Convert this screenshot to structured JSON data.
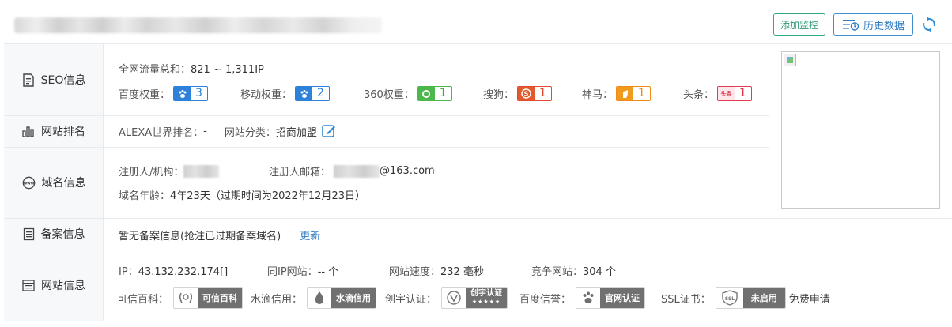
{
  "header": {
    "add_monitor": "添加监控",
    "history_data": "历史数据"
  },
  "rows": {
    "seo": {
      "label": "SEO信息"
    },
    "rank": {
      "label": "网站排名"
    },
    "domain": {
      "label": "域名信息"
    },
    "icp": {
      "label": "备案信息"
    },
    "site": {
      "label": "网站信息"
    }
  },
  "seo": {
    "traffic_label": "全网流量总和：",
    "traffic_value": "821 ~ 1,311IP",
    "weights": [
      {
        "label": "百度权重：",
        "value": "3",
        "color": "#2e81d8"
      },
      {
        "label": "移动权重：",
        "value": "2",
        "color": "#2e81d8"
      },
      {
        "label": "360权重：",
        "value": "1",
        "color": "#4cb84c"
      },
      {
        "label": "搜狗：",
        "value": "1",
        "color": "#e04a2f"
      },
      {
        "label": "神马：",
        "value": "1",
        "color": "#ef8a16"
      },
      {
        "label": "头条：",
        "value": "1",
        "color": "#e23c50"
      }
    ],
    "toutiao_icon_text": "头条"
  },
  "rank": {
    "alexa_label": "ALEXA世界排名：",
    "alexa_value": "-",
    "category_label": "网站分类：",
    "category_value": "招商加盟"
  },
  "domain": {
    "registrant_label": "注册人/机构：",
    "email_label": "注册人邮箱：",
    "email_suffix": "@163.com",
    "age_label": "域名年龄：",
    "age_value": "4年23天（过期时间为2022年12月23日）"
  },
  "icp": {
    "text": "暂无备案信息(抢注已过期备案域名)",
    "update_link": "更新"
  },
  "site": {
    "ip_label": "IP：",
    "ip_value": "43.132.232.174[]",
    "same_ip_label": "同IP网站：",
    "same_ip_value": "-- 个",
    "speed_label": "网站速度：",
    "speed_value": "232 毫秒",
    "competitor_label": "竞争网站：",
    "competitor_value": "304 个",
    "trust": [
      {
        "label": "可信百科：",
        "badge": "可信百科"
      },
      {
        "label": "水滴信用：",
        "badge": "水滴信用"
      },
      {
        "label": "创宇认证：",
        "badge": "创宇认证"
      },
      {
        "label": "百度信誉：",
        "badge": "官网认证"
      },
      {
        "label": "SSL证书：",
        "badge": "未启用"
      }
    ],
    "chuangyu_stars": "★★★★★",
    "ssl_icon_text": "SSL",
    "free_apply": "免费申请"
  }
}
